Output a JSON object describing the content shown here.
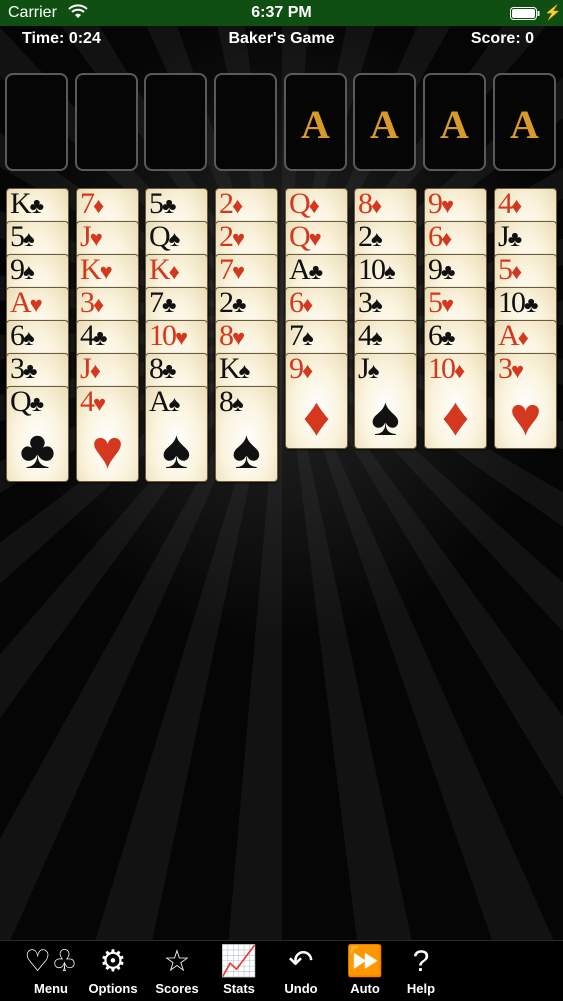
{
  "status_bar": {
    "carrier": "Carrier",
    "time": "6:37 PM"
  },
  "header": {
    "time": "Time: 0:24",
    "title": "Baker's Game",
    "score": "Score: 0"
  },
  "free_cells": [
    {
      "card": ""
    },
    {
      "card": ""
    },
    {
      "card": ""
    },
    {
      "card": ""
    }
  ],
  "foundations": [
    {
      "rank": "A"
    },
    {
      "rank": "A"
    },
    {
      "rank": "A"
    },
    {
      "rank": "A"
    }
  ],
  "tableau": [
    [
      {
        "rank": "K",
        "suit": "♣",
        "color": "black"
      },
      {
        "rank": "5",
        "suit": "♠",
        "color": "black"
      },
      {
        "rank": "9",
        "suit": "♠",
        "color": "black"
      },
      {
        "rank": "A",
        "suit": "♥",
        "color": "red"
      },
      {
        "rank": "6",
        "suit": "♠",
        "color": "black"
      },
      {
        "rank": "3",
        "suit": "♣",
        "color": "black"
      },
      {
        "rank": "Q",
        "suit": "♣",
        "color": "black"
      }
    ],
    [
      {
        "rank": "7",
        "suit": "♦",
        "color": "red"
      },
      {
        "rank": "J",
        "suit": "♥",
        "color": "red"
      },
      {
        "rank": "K",
        "suit": "♥",
        "color": "red"
      },
      {
        "rank": "3",
        "suit": "♦",
        "color": "red"
      },
      {
        "rank": "4",
        "suit": "♣",
        "color": "black"
      },
      {
        "rank": "J",
        "suit": "♦",
        "color": "red"
      },
      {
        "rank": "4",
        "suit": "♥",
        "color": "red"
      }
    ],
    [
      {
        "rank": "5",
        "suit": "♣",
        "color": "black"
      },
      {
        "rank": "Q",
        "suit": "♠",
        "color": "black"
      },
      {
        "rank": "K",
        "suit": "♦",
        "color": "red"
      },
      {
        "rank": "7",
        "suit": "♣",
        "color": "black"
      },
      {
        "rank": "10",
        "suit": "♥",
        "color": "red"
      },
      {
        "rank": "8",
        "suit": "♣",
        "color": "black"
      },
      {
        "rank": "A",
        "suit": "♠",
        "color": "black"
      }
    ],
    [
      {
        "rank": "2",
        "suit": "♦",
        "color": "red"
      },
      {
        "rank": "2",
        "suit": "♥",
        "color": "red"
      },
      {
        "rank": "7",
        "suit": "♥",
        "color": "red"
      },
      {
        "rank": "2",
        "suit": "♣",
        "color": "black"
      },
      {
        "rank": "8",
        "suit": "♥",
        "color": "red"
      },
      {
        "rank": "K",
        "suit": "♠",
        "color": "black"
      },
      {
        "rank": "8",
        "suit": "♠",
        "color": "black"
      }
    ],
    [
      {
        "rank": "Q",
        "suit": "♦",
        "color": "red"
      },
      {
        "rank": "Q",
        "suit": "♥",
        "color": "red"
      },
      {
        "rank": "A",
        "suit": "♣",
        "color": "black"
      },
      {
        "rank": "6",
        "suit": "♦",
        "color": "red"
      },
      {
        "rank": "7",
        "suit": "♠",
        "color": "black"
      },
      {
        "rank": "9",
        "suit": "♦",
        "color": "red"
      }
    ],
    [
      {
        "rank": "8",
        "suit": "♦",
        "color": "red"
      },
      {
        "rank": "2",
        "suit": "♠",
        "color": "black"
      },
      {
        "rank": "10",
        "suit": "♠",
        "color": "black"
      },
      {
        "rank": "3",
        "suit": "♠",
        "color": "black"
      },
      {
        "rank": "4",
        "suit": "♠",
        "color": "black"
      },
      {
        "rank": "J",
        "suit": "♠",
        "color": "black"
      }
    ],
    [
      {
        "rank": "9",
        "suit": "♥",
        "color": "red"
      },
      {
        "rank": "6",
        "suit": "♦",
        "color": "red"
      },
      {
        "rank": "9",
        "suit": "♣",
        "color": "black"
      },
      {
        "rank": "5",
        "suit": "♥",
        "color": "red"
      },
      {
        "rank": "6",
        "suit": "♣",
        "color": "black"
      },
      {
        "rank": "10",
        "suit": "♦",
        "color": "red"
      }
    ],
    [
      {
        "rank": "4",
        "suit": "♦",
        "color": "red"
      },
      {
        "rank": "J",
        "suit": "♣",
        "color": "black"
      },
      {
        "rank": "5",
        "suit": "♦",
        "color": "red"
      },
      {
        "rank": "10",
        "suit": "♣",
        "color": "black"
      },
      {
        "rank": "A",
        "suit": "♦",
        "color": "red"
      },
      {
        "rank": "3",
        "suit": "♥",
        "color": "red"
      }
    ]
  ],
  "toolbar": [
    {
      "label": "Menu",
      "icon": "card-suits-icon",
      "glyph": "♡♧"
    },
    {
      "label": "Options",
      "icon": "gears-icon",
      "glyph": "⚙"
    },
    {
      "label": "Scores",
      "icon": "star-icon",
      "glyph": "☆"
    },
    {
      "label": "Stats",
      "icon": "chart-icon",
      "glyph": "📈"
    },
    {
      "label": "Undo",
      "icon": "undo-icon",
      "glyph": "↶"
    },
    {
      "label": "Auto",
      "icon": "fast-forward-icon",
      "glyph": "⏩"
    },
    {
      "label": "Help",
      "icon": "help-icon",
      "glyph": "?"
    }
  ],
  "colors": {
    "status_bar": "#0f4f12",
    "red_suit": "#d4381e",
    "ace_gold": "#d89b2a"
  }
}
